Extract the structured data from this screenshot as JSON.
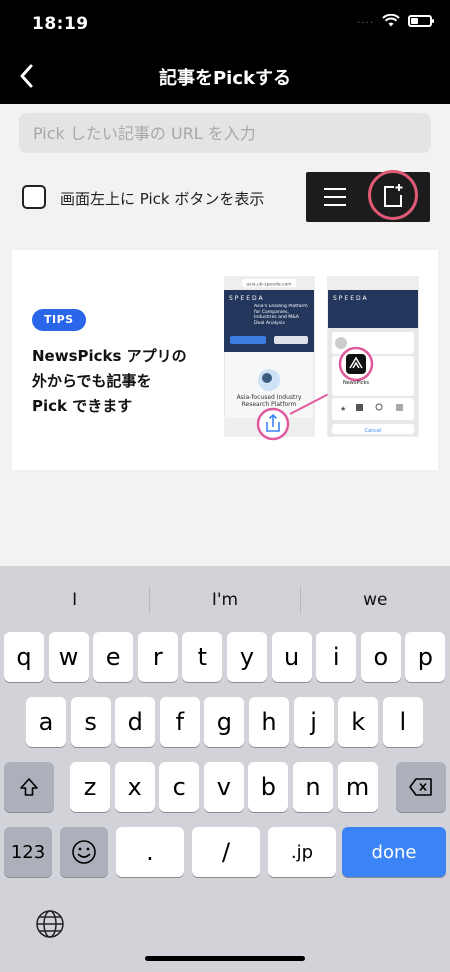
{
  "status": {
    "time": "18:19",
    "signal_dots": "....",
    "battery_level": 0.4
  },
  "nav": {
    "title": "記事をPickする",
    "back_icon": "chevron-left-icon"
  },
  "url_input": {
    "placeholder": "Pick したい記事の URL を入力",
    "value": ""
  },
  "pick_button_option": {
    "label": "画面左上に Pick ボタンを表示",
    "checked": false
  },
  "tips": {
    "badge": "TIPS",
    "line1": "NewsPicks アプリの",
    "line2": "外からでも記事を",
    "line3": "Pick できます",
    "illustration": {
      "url": "asia.ub-speeda.com",
      "brand": "SPEEDA",
      "headline": "Asia's Leading Platform for Companies, Industries and M&A Deal Analysis",
      "subhead": "Asia-focused Industry Research Platform",
      "app_name": "NewsPicks",
      "cancel": "Cancel",
      "accent_color": "#e05a9e"
    }
  },
  "keyboard": {
    "suggestions": [
      "I",
      "I'm",
      "we"
    ],
    "row1": [
      "q",
      "w",
      "e",
      "r",
      "t",
      "y",
      "u",
      "i",
      "o",
      "p"
    ],
    "row2": [
      "a",
      "s",
      "d",
      "f",
      "g",
      "h",
      "j",
      "k",
      "l"
    ],
    "row3": [
      "z",
      "x",
      "c",
      "v",
      "b",
      "n",
      "m"
    ],
    "numbers_key": "123",
    "dot_key": ".",
    "slash_key": "/",
    "jp_key": ".jp",
    "done_key": "done"
  },
  "colors": {
    "accent": "#2a66ea",
    "highlight": "#e05a75",
    "done": "#3a84f5"
  }
}
